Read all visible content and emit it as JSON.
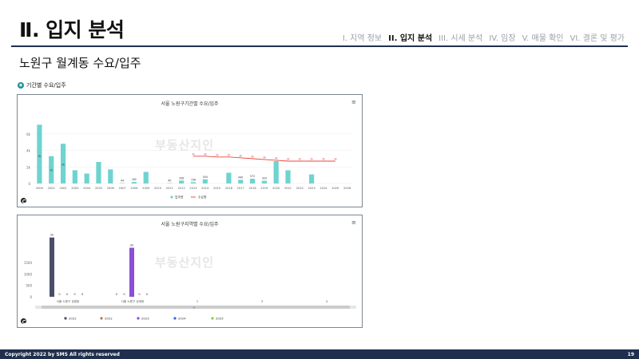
{
  "header": {
    "title": "Ⅱ. 입지 분석",
    "nav": [
      "I. 지역 정보",
      "II. 입지 분석",
      "III. 시세 분석",
      "IV. 임장",
      "V. 매물 확인",
      "VI. 결론 및 평가"
    ],
    "active_index": 1
  },
  "subtitle": "노원구 월계동 수요/입주",
  "section_label": "기간별 수요/입주",
  "watermark": "부동산지인",
  "colors": {
    "navy": "#1f2f4d",
    "teal": "#6fd3cf",
    "red": "#e8453c",
    "purple": "#8a4fd6"
  },
  "chart_data": [
    {
      "type": "bar",
      "title": "서울 노원구기간별 수요/입주",
      "categories": [
        "2000",
        "2001",
        "2002",
        "2003",
        "2004",
        "2005",
        "2006",
        "2007",
        "2008",
        "2009",
        "2010",
        "2011",
        "2012",
        "2013",
        "2014",
        "2015",
        "2016",
        "2017",
        "2018",
        "2019",
        "2020",
        "2021",
        "2022",
        "2023",
        "2024",
        "2025",
        "2026"
      ],
      "series": [
        {
          "name": "입주량",
          "type": "bar",
          "values": [
            7100,
            3300,
            4800,
            1600,
            1200,
            2600,
            1700,
            44,
            182,
            1400,
            0,
            40,
            358,
            158,
            504,
            0,
            1300,
            440,
            572,
            329,
            2700,
            1600,
            0,
            1100,
            0,
            0,
            0
          ]
        },
        {
          "name": "수요량",
          "type": "line",
          "values": [
            null,
            null,
            null,
            null,
            null,
            null,
            null,
            null,
            null,
            null,
            null,
            null,
            null,
            3300,
            3300,
            3200,
            3200,
            3100,
            3000,
            2900,
            2800,
            2700,
            2700,
            2700,
            2700,
            2700,
            null
          ]
        }
      ],
      "bar_labels": [
        {
          "index": 0,
          "text": "3k"
        },
        {
          "index": 1,
          "text": "1k"
        },
        {
          "index": 2,
          "text": "2k"
        },
        {
          "index": 7,
          "text": "44"
        },
        {
          "index": 8,
          "text": "182"
        },
        {
          "index": 11,
          "text": "40"
        },
        {
          "index": 12,
          "text": "358"
        },
        {
          "index": 13,
          "text": "158"
        },
        {
          "index": 14,
          "text": "504"
        },
        {
          "index": 17,
          "text": "440"
        },
        {
          "index": 18,
          "text": "572"
        },
        {
          "index": 19,
          "text": "329"
        }
      ],
      "yticks": [
        "0",
        "2k",
        "4k",
        "6k"
      ],
      "ylim": [
        0,
        8000
      ],
      "grid": true,
      "legend_position": "bottom"
    },
    {
      "type": "bar",
      "title": "서울 노원구지역별 수요/입주",
      "categories": [
        "서울 노원구 공릉동",
        "서울 노원구 상계동",
        "2",
        "3",
        "4"
      ],
      "series": [
        {
          "name": "2022",
          "color": "#4a4e69",
          "values": [
            2600,
            0
          ]
        },
        {
          "name": "2022",
          "color": "#b07a4f",
          "values": [
            0,
            0
          ]
        },
        {
          "name": "2023",
          "color": "#8a4fd6",
          "values": [
            0,
            2150
          ]
        },
        {
          "name": "2024",
          "color": "#3f5fd9",
          "values": [
            0,
            0
          ]
        },
        {
          "name": "2025",
          "color": "#7fcf3c",
          "values": [
            0,
            0
          ]
        }
      ],
      "bar_labels": [
        "2k",
        "0",
        "0",
        "0",
        "0",
        "0",
        "0",
        "2k",
        "0",
        "0"
      ],
      "yticks": [
        "0",
        "500",
        "1000",
        "1500"
      ],
      "ylim": [
        0,
        2800
      ],
      "legend_position": "bottom",
      "scrollbar_label": "≡"
    }
  ],
  "footer": {
    "copyright": "Copyright 2022 by SMS All rights reserved",
    "page": "19"
  }
}
